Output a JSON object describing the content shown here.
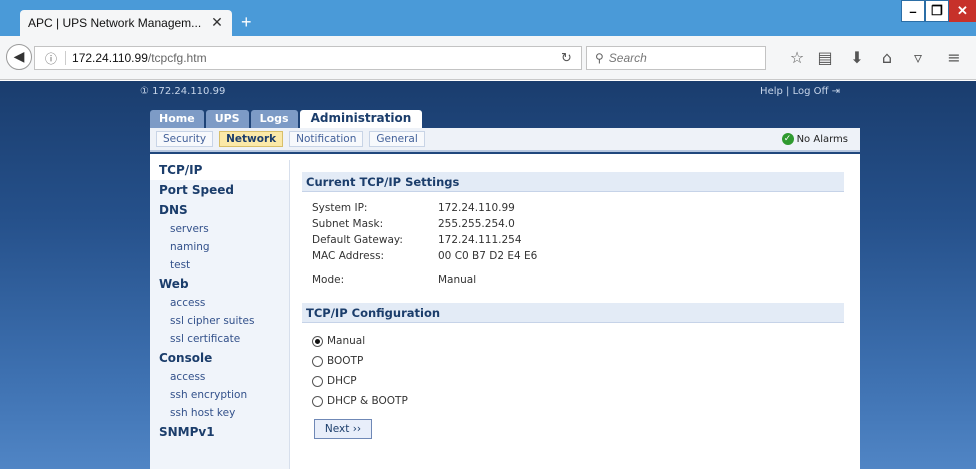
{
  "browser": {
    "tab_title": "APC | UPS Network Managem...",
    "tab_close": "✕",
    "new_tab": "+",
    "url_host": "172.24.110.99",
    "url_path": "/tcpcfg.htm",
    "search_placeholder": "Search"
  },
  "header": {
    "device_ip": "① 172.24.110.99",
    "help": "Help",
    "divider": "|",
    "log_off": "Log Off"
  },
  "main_tabs": [
    "Home",
    "UPS",
    "Logs",
    "Administration"
  ],
  "sub_tabs": [
    "Security",
    "Network",
    "Notification",
    "General"
  ],
  "alarm_status": "No Alarms",
  "sidebar": {
    "tcpip": "TCP/IP",
    "port_speed": "Port Speed",
    "dns": "DNS",
    "dns_items": [
      "servers",
      "naming",
      "test"
    ],
    "web": "Web",
    "web_items": [
      "access",
      "ssl cipher suites",
      "ssl certificate"
    ],
    "console": "Console",
    "console_items": [
      "access",
      "ssh encryption",
      "ssh host key"
    ],
    "snmpv1": "SNMPv1"
  },
  "current_settings": {
    "title": "Current TCP/IP Settings",
    "rows": [
      {
        "label": "System IP:",
        "value": "172.24.110.99"
      },
      {
        "label": "Subnet Mask:",
        "value": "255.255.254.0"
      },
      {
        "label": "Default Gateway:",
        "value": "172.24.111.254"
      },
      {
        "label": "MAC Address:",
        "value": "00 C0 B7 D2 E4 E6"
      }
    ],
    "mode_label": "Mode:",
    "mode_value": "Manual"
  },
  "configuration": {
    "title": "TCP/IP Configuration",
    "options": [
      "Manual",
      "BOOTP",
      "DHCP",
      "DHCP & BOOTP"
    ],
    "selected": "Manual",
    "next_label": "Next ››"
  },
  "colors": {
    "titlebar": "#4a9ad8",
    "page_bg": "#25508a",
    "accent": "#1b3d6b",
    "alarm_ok": "#2f9a2f"
  }
}
